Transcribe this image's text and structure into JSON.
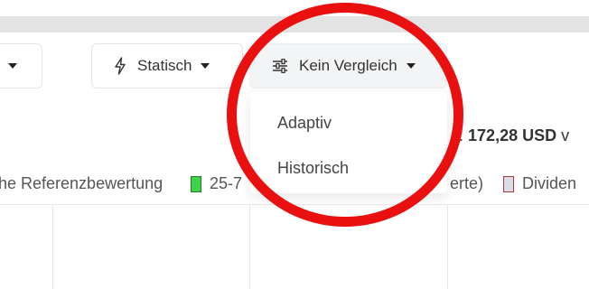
{
  "toolbar": {
    "left_button_caret": "dropdown",
    "static_button": {
      "icon": "lightning-icon",
      "label": "Statisch"
    },
    "compare_button": {
      "icon": "sliders-icon",
      "label": "Kein Vergleich"
    }
  },
  "dropdown": {
    "items": [
      "Adaptiv",
      "Historisch"
    ]
  },
  "price": {
    "prefix": ":",
    "value": "172,28 USD",
    "suffix": "v"
  },
  "legend": {
    "item1_fragment": "he Referenzbewertung",
    "item2_fragment": "25-7",
    "item3_fragment": "erte)",
    "item4_fragment": "Dividen"
  },
  "colors": {
    "highlight_circle": "#ea1010",
    "legend_green": "#3dd34b",
    "legend_gray": "#dcdce6"
  }
}
